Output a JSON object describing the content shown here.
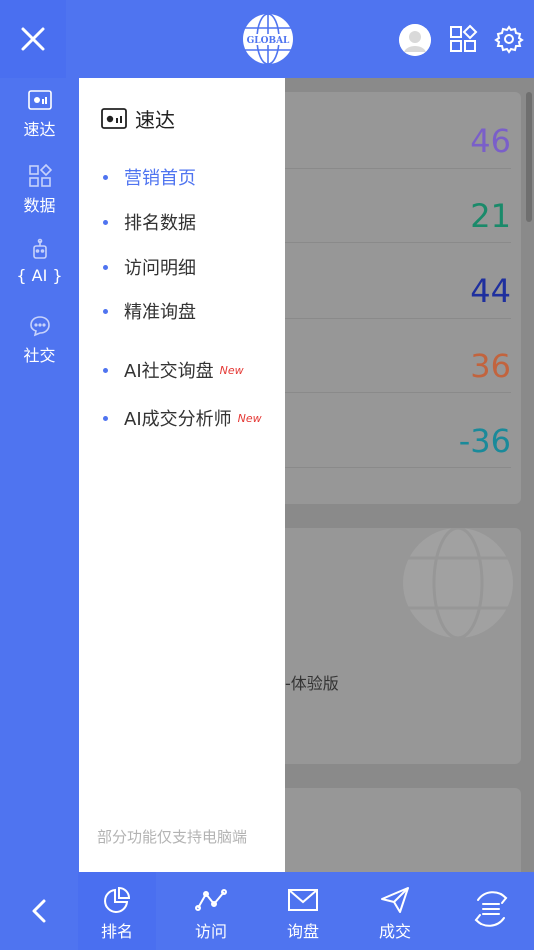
{
  "top": {
    "logo_text": "GLOBAL"
  },
  "rail": {
    "items": [
      {
        "label": "速达",
        "icon": "dashboard-icon"
      },
      {
        "label": "数据",
        "icon": "apps-icon"
      },
      {
        "label": "{ AI }",
        "icon": "ai-icon"
      },
      {
        "label": "社交",
        "icon": "chat-icon"
      }
    ]
  },
  "background": {
    "metrics": [
      "46",
      "21",
      "44",
      "36",
      "-36"
    ],
    "metric_colors": [
      "#7a5fc9",
      "#1a8a6a",
      "#1e2f9e",
      "#c2643e",
      "#1a8a9a"
    ],
    "card_text": "-体验版"
  },
  "drawer": {
    "title": "速达",
    "items": [
      {
        "label": "营销首页",
        "active": true
      },
      {
        "label": "排名数据"
      },
      {
        "label": "访问明细"
      },
      {
        "label": "精准询盘"
      },
      {
        "label": "AI社交询盘",
        "badge": "New"
      },
      {
        "label": "AI成交分析师",
        "badge": "New"
      }
    ],
    "footer": "部分功能仅支持电脑端"
  },
  "bottom": {
    "tabs": [
      {
        "label": "排名",
        "icon": "pie-chart-icon"
      },
      {
        "label": "访问",
        "icon": "line-trend-icon"
      },
      {
        "label": "询盘",
        "icon": "mail-icon"
      },
      {
        "label": "成交",
        "icon": "send-icon"
      }
    ]
  },
  "colors": {
    "brand": "#4f74f0",
    "accent_active": "#4f74f0",
    "badge_new": "#e53935"
  }
}
